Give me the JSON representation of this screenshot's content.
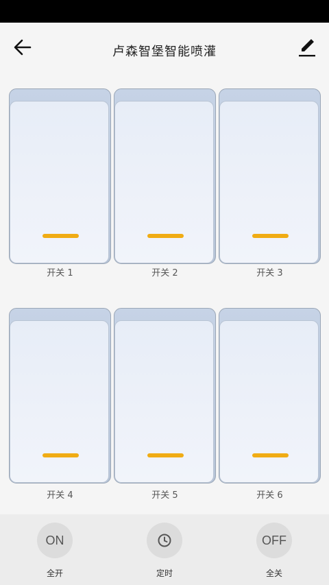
{
  "header": {
    "title": "卢森智堡智能喷灌",
    "back_icon": "arrow-left-icon",
    "edit_icon": "pencil-icon"
  },
  "switches": [
    {
      "label": "开关 1",
      "state": "off"
    },
    {
      "label": "开关 2",
      "state": "off"
    },
    {
      "label": "开关 3",
      "state": "off"
    },
    {
      "label": "开关 4",
      "state": "off"
    },
    {
      "label": "开关 5",
      "state": "off"
    },
    {
      "label": "开关 6",
      "state": "off"
    }
  ],
  "actions": {
    "all_on": {
      "icon_text": "ON",
      "label": "全开"
    },
    "timer": {
      "icon": "clock-icon",
      "label": "定时"
    },
    "all_off": {
      "icon_text": "OFF",
      "label": "全关"
    }
  },
  "colors": {
    "indicator": "#f0ac14",
    "switch_face": "#e7edf7",
    "bottom_bar": "#ececec"
  }
}
